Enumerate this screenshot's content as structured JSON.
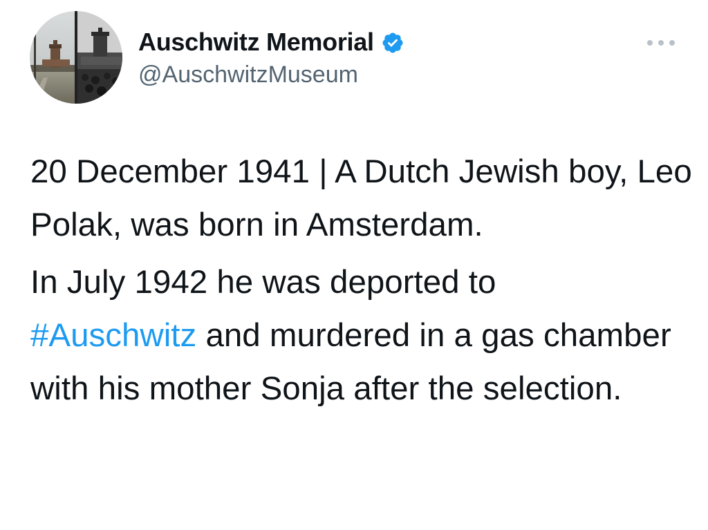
{
  "author": {
    "display_name": "Auschwitz Memorial",
    "handle": "@AuschwitzMuseum",
    "verified": true,
    "verified_icon": "verified-badge-icon",
    "more_icon": "more-options-icon"
  },
  "tweet": {
    "paragraph1": "20 December 1941 | A Dutch Jewish boy, Leo Polak, was born in Amsterdam.",
    "paragraph2_before": "In July 1942 he was deported to",
    "hashtag": "#Auschwitz",
    "paragraph2_after": "and murdered in a gas chamber with his mother Sonja after the selection."
  },
  "colors": {
    "text": "#0f1419",
    "secondary_text": "#536471",
    "link": "#1d9bf0",
    "verified": "#1d9bf0"
  }
}
